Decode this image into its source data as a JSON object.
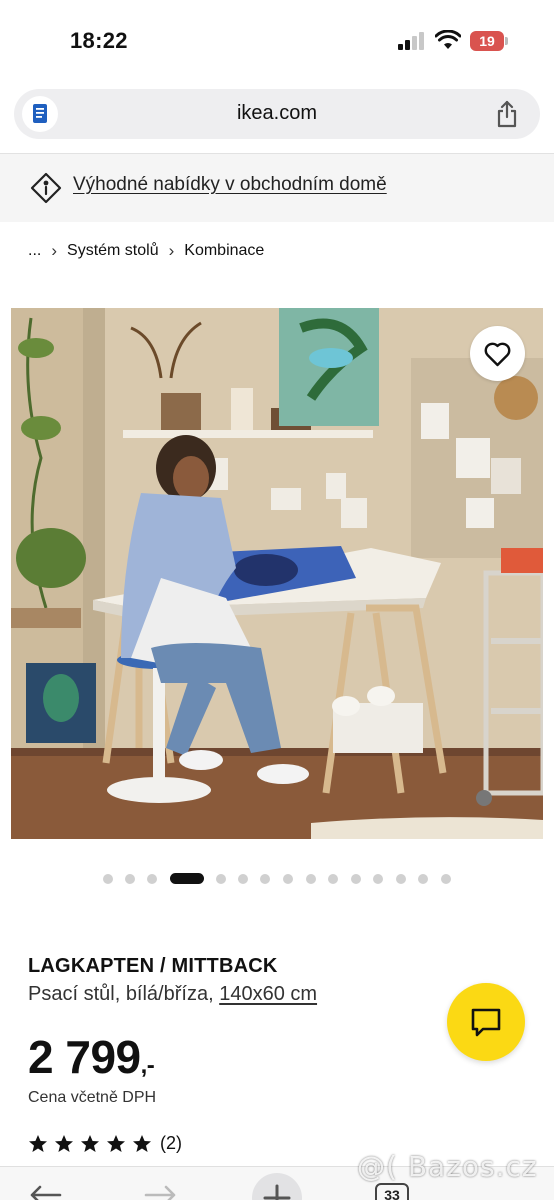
{
  "status_bar": {
    "time": "18:22",
    "battery": "19"
  },
  "browser": {
    "url": "ikea.com"
  },
  "promo": {
    "text": "Výhodné nabídky v obchodním domě",
    "icon": "tag-location-icon"
  },
  "breadcrumb": {
    "ellipsis": "...",
    "items": [
      "Systém stolů",
      "Kombinace"
    ]
  },
  "gallery": {
    "total_images": 16,
    "active_index": 3
  },
  "product": {
    "name": "LAGKAPTEN / MITTBACK",
    "description": "Psací stůl, bílá/bříza, ",
    "size": "140x60 cm",
    "price": "2 799",
    "price_suffix": ",-",
    "vat_note": "Cena včetně DPH",
    "rating": 5,
    "rating_count": "(2)"
  },
  "toolbar": {
    "tab_count": "33"
  },
  "watermark": "@( Bazos.cz",
  "colors": {
    "accent_yellow": "#fbd914",
    "battery_red": "#d9534f"
  }
}
